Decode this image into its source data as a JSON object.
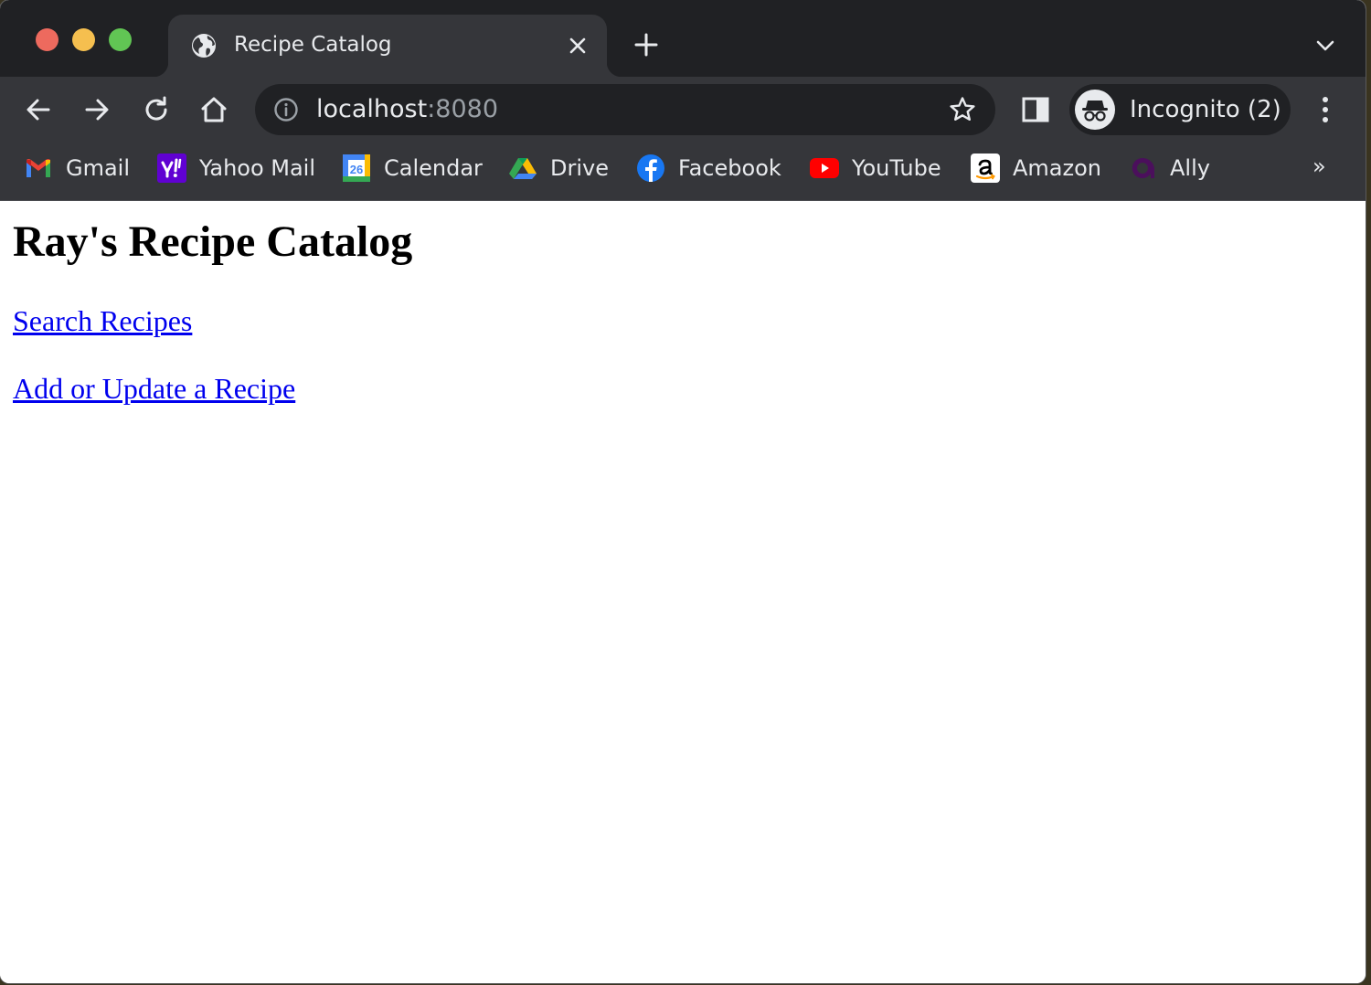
{
  "browser": {
    "window_controls": [
      "close",
      "minimize",
      "maximize"
    ],
    "tab": {
      "title": "Recipe Catalog",
      "favicon": "globe-icon"
    },
    "omnibox": {
      "host": "localhost",
      "port": ":8080"
    },
    "profile": {
      "label": "Incognito (2)"
    },
    "bookmarks": [
      {
        "label": "Gmail",
        "icon": "gmail-icon"
      },
      {
        "label": "Yahoo Mail",
        "icon": "yahoo-icon"
      },
      {
        "label": "Calendar",
        "icon": "calendar-icon"
      },
      {
        "label": "Drive",
        "icon": "drive-icon"
      },
      {
        "label": "Facebook",
        "icon": "facebook-icon"
      },
      {
        "label": "YouTube",
        "icon": "youtube-icon"
      },
      {
        "label": "Amazon",
        "icon": "amazon-icon"
      },
      {
        "label": "Ally",
        "icon": "ally-icon"
      }
    ],
    "bookmarks_overflow": "»",
    "calendar_day": "26"
  },
  "page": {
    "title": "Ray's Recipe Catalog",
    "links": [
      {
        "label": "Search Recipes"
      },
      {
        "label": "Add or Update a Recipe"
      }
    ]
  },
  "colors": {
    "link": "#0000ee",
    "chrome_dark": "#202124",
    "chrome_toolbar": "#35363a"
  }
}
